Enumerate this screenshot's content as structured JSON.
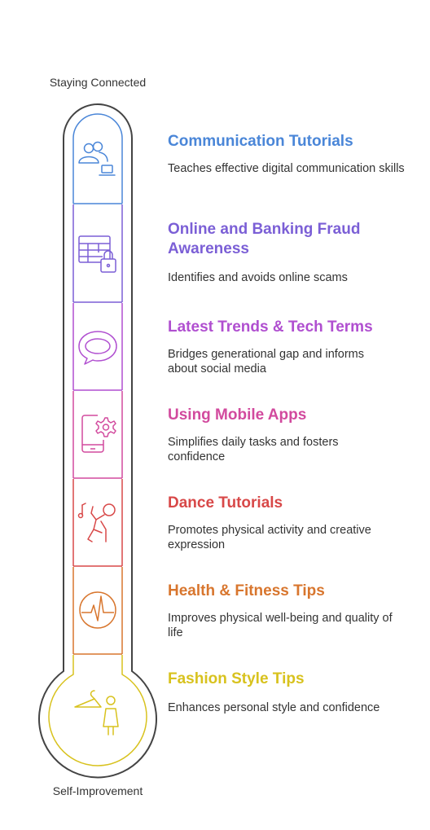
{
  "labels": {
    "top": "Staying Connected",
    "bottom": "Self-Improvement"
  },
  "items": [
    {
      "title": "Communication Tutorials",
      "description": "Teaches effective digital communication skills",
      "color": "#4a86d8",
      "icon": "users-laptop-icon"
    },
    {
      "title": "Online and Banking Fraud Awareness",
      "description": "Identifies and avoids online scams",
      "color": "#7b5fd6",
      "icon": "table-lock-icon"
    },
    {
      "title": "Latest Trends & Tech Terms",
      "description": "Bridges generational gap and informs about social media",
      "color": "#b04fd0",
      "icon": "speech-bubble-icon"
    },
    {
      "title": "Using Mobile Apps",
      "description": "Simplifies daily tasks and fosters confidence",
      "color": "#d24a9e",
      "icon": "phone-gear-icon"
    },
    {
      "title": "Dance Tutorials",
      "description": "Promotes physical activity and creative expression",
      "color": "#d84848",
      "icon": "dancer-icon"
    },
    {
      "title": "Health & Fitness Tips",
      "description": "Improves physical well-being and quality of life",
      "color": "#d8762e",
      "icon": "heartbeat-icon"
    },
    {
      "title": "Fashion Style Tips",
      "description": "Enhances personal style and confidence",
      "color": "#d8c21e",
      "icon": "hanger-person-icon"
    }
  ]
}
